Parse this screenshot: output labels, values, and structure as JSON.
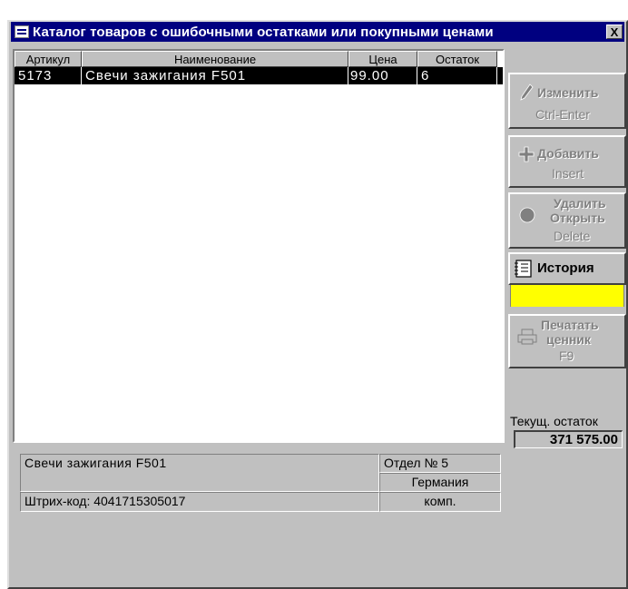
{
  "window": {
    "title": "Каталог товаров с ошибочными остатками или покупными ценами",
    "close_label": "X"
  },
  "table": {
    "columns": [
      "Артикул",
      "Наименование",
      "Цена",
      "Остаток"
    ],
    "rows": [
      {
        "article": "5173",
        "name": "Свечи  зажигания  F501",
        "price": "99.00",
        "stock": "6",
        "selected": true
      }
    ]
  },
  "buttons": {
    "edit": {
      "label": "Изменить",
      "shortcut": "Ctrl-Enter",
      "icon": "pencil-icon"
    },
    "add": {
      "label": "Добавить",
      "shortcut": "Insert",
      "icon": "plus-icon"
    },
    "delete": {
      "label_line1": "Удалить",
      "label_line2": "Открыть",
      "shortcut": "Delete",
      "icon": "circle-icon"
    },
    "history": {
      "label": "История",
      "icon": "notebook-icon"
    },
    "print": {
      "label_line1": "Печатать",
      "label_line2": "ценник",
      "shortcut": "F9",
      "icon": "printer-icon"
    }
  },
  "stock": {
    "label": "Текущ. остаток",
    "value": "371 575.00"
  },
  "info": {
    "name": "Свечи  зажигания  F501",
    "department": "Отдел № 5",
    "country": "Германия",
    "barcode": "Штрих-код: 4041715305017",
    "type": "комп."
  },
  "colors": {
    "titlebar": "#000080",
    "window_bg": "#c0c0c0",
    "history_highlight": "#ffff00",
    "selected_row": "#000000"
  }
}
